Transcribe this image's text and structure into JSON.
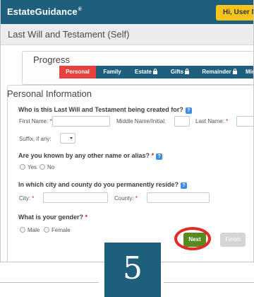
{
  "header": {
    "brand": "EstateGuidance",
    "brand_mark": "®",
    "greeting": "Hi, User Name"
  },
  "page": {
    "title": "Last Will and Testament (Self)"
  },
  "progress": {
    "title": "Progress",
    "tabs": [
      {
        "label": "Personal",
        "active": true,
        "locked": false
      },
      {
        "label": "Family",
        "active": false,
        "locked": false
      },
      {
        "label": "Estate",
        "active": false,
        "locked": true
      },
      {
        "label": "Gifts",
        "active": false,
        "locked": true
      },
      {
        "label": "Remainder",
        "active": false,
        "locked": true
      },
      {
        "label": "Mino",
        "active": false,
        "locked": false
      }
    ]
  },
  "personal_info": {
    "title": "Personal Information",
    "q_for_whom": "Who is this Last Will and Testament being created for?",
    "first_name_label": "First Name:",
    "middle_name_label": "Middle Name/Initial:",
    "last_name_label": "Last Name:",
    "suffix_label": "Suffix, if any:",
    "q_alias": "Are you known by any other name or alias?",
    "alias_yes": "Yes",
    "alias_no": "No",
    "q_reside": "In which city and county do you permanently reside?",
    "city_label": "City:",
    "county_label": "County:",
    "q_gender": "What is your gender?",
    "gender_male": "Male",
    "gender_female": "Female",
    "required_mark": "*",
    "help_glyph": "?"
  },
  "actions": {
    "next_label": "Next",
    "finish_label": "Finish"
  },
  "step_badge": "5",
  "colors": {
    "header_bg": "#1d5f7d",
    "active_tab": "#e8413d",
    "next_button": "#588a22",
    "highlight_circle": "#e22b25",
    "greeting_bg": "#f5c51c"
  }
}
